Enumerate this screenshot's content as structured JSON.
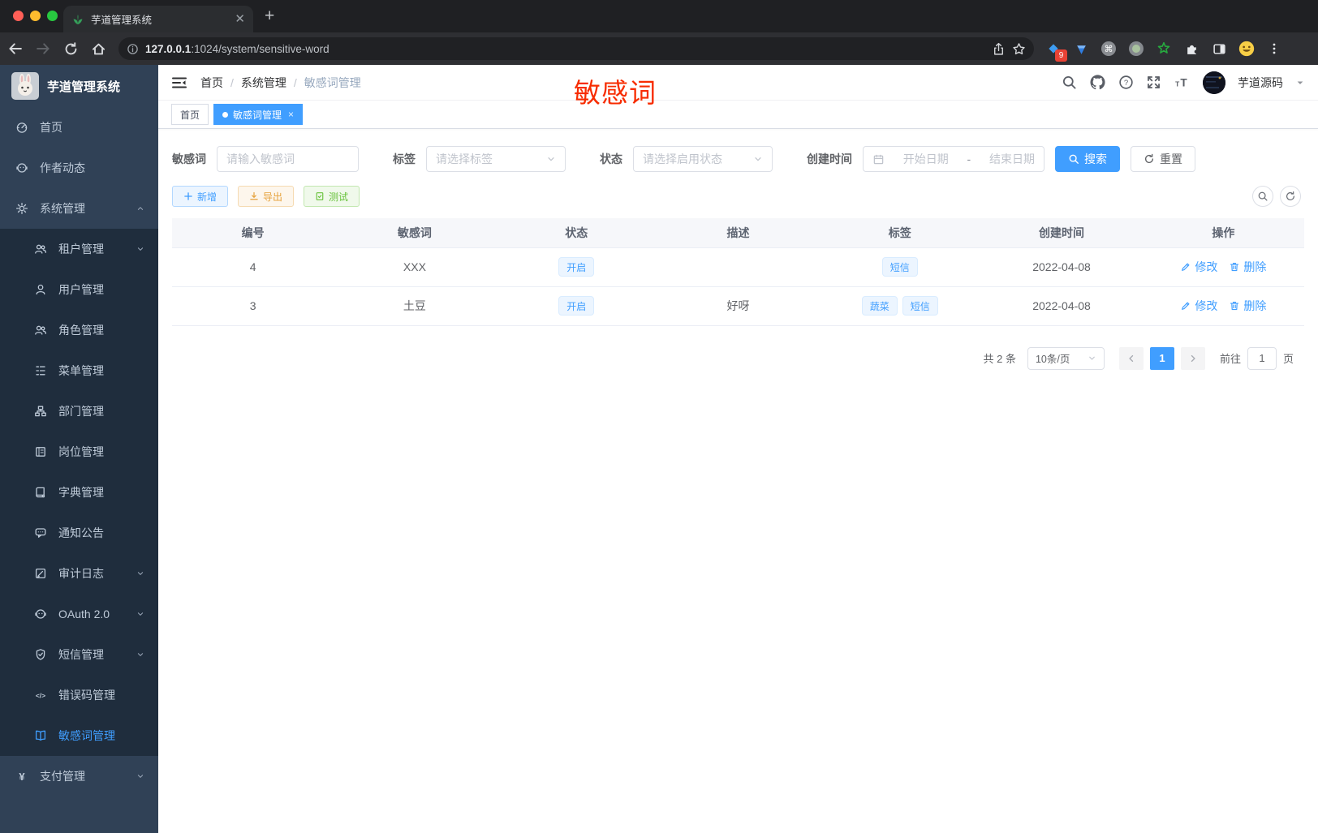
{
  "colors": {
    "primary": "#409EFF",
    "annotation_red": "#f72c00",
    "sidebar_bg": "#304156",
    "submenu_bg": "#1f2d3d"
  },
  "browser": {
    "tab_title": "芋道管理系统",
    "url_host": "127.0.0.1",
    "url_rest": ":1024/system/sensitive-word",
    "extension_badge": "9"
  },
  "sidebar": {
    "title": "芋道管理系统",
    "items": [
      {
        "label": "首页",
        "icon": "gauge",
        "level": 1
      },
      {
        "label": "作者动态",
        "icon": "robot",
        "level": 1
      },
      {
        "label": "系统管理",
        "icon": "gear",
        "level": 1,
        "arrow": "up"
      },
      {
        "label": "租户管理",
        "icon": "users",
        "level": 2,
        "arrow": "down"
      },
      {
        "label": "用户管理",
        "icon": "user",
        "level": 2
      },
      {
        "label": "角色管理",
        "icon": "users",
        "level": 2
      },
      {
        "label": "菜单管理",
        "icon": "tree",
        "level": 2
      },
      {
        "label": "部门管理",
        "icon": "org",
        "level": 2
      },
      {
        "label": "岗位管理",
        "icon": "badge",
        "level": 2
      },
      {
        "label": "字典管理",
        "icon": "dict",
        "level": 2
      },
      {
        "label": "通知公告",
        "icon": "notice",
        "level": 2
      },
      {
        "label": "审计日志",
        "icon": "log",
        "level": 2,
        "arrow": "down"
      },
      {
        "label": "OAuth 2.0",
        "icon": "robot",
        "level": 2,
        "arrow": "down"
      },
      {
        "label": "短信管理",
        "icon": "shield",
        "level": 2,
        "arrow": "down"
      },
      {
        "label": "错误码管理",
        "icon": "code",
        "level": 2
      },
      {
        "label": "敏感词管理",
        "icon": "openbook",
        "level": 2,
        "active": true
      },
      {
        "label": "支付管理",
        "icon": "yen",
        "level": 1,
        "arrow": "down"
      }
    ]
  },
  "header": {
    "breadcrumb": [
      "首页",
      "系统管理",
      "敏感词管理"
    ],
    "annotation": "敏感词",
    "username": "芋道源码"
  },
  "tagsbar": {
    "tabs": [
      {
        "label": "首页",
        "active": false
      },
      {
        "label": "敏感词管理",
        "active": true,
        "closable": true
      }
    ]
  },
  "filters": {
    "word": {
      "label": "敏感词",
      "placeholder": "请输入敏感词"
    },
    "tag": {
      "label": "标签",
      "placeholder": "请选择标签"
    },
    "status": {
      "label": "状态",
      "placeholder": "请选择启用状态"
    },
    "time": {
      "label": "创建时间",
      "start_placeholder": "开始日期",
      "separator": "-",
      "end_placeholder": "结束日期"
    },
    "search_label": "搜索",
    "reset_label": "重置"
  },
  "toolbar": {
    "add_label": "新增",
    "export_label": "导出",
    "test_label": "测试"
  },
  "table": {
    "headers": [
      "编号",
      "敏感词",
      "状态",
      "描述",
      "标签",
      "创建时间",
      "操作"
    ],
    "action_labels": {
      "edit": "修改",
      "delete": "删除"
    },
    "rows": [
      {
        "id": "4",
        "word": "XXX",
        "status": "开启",
        "desc": "",
        "tags": [
          "短信"
        ],
        "created": "2022-04-08"
      },
      {
        "id": "3",
        "word": "土豆",
        "status": "开启",
        "desc": "好呀",
        "tags": [
          "蔬菜",
          "短信"
        ],
        "created": "2022-04-08"
      }
    ]
  },
  "pagination": {
    "total": "共 2 条",
    "page_size": "10条/页",
    "current_page": "1",
    "goto_label": "前往",
    "goto_value": "1",
    "goto_unit": "页"
  }
}
